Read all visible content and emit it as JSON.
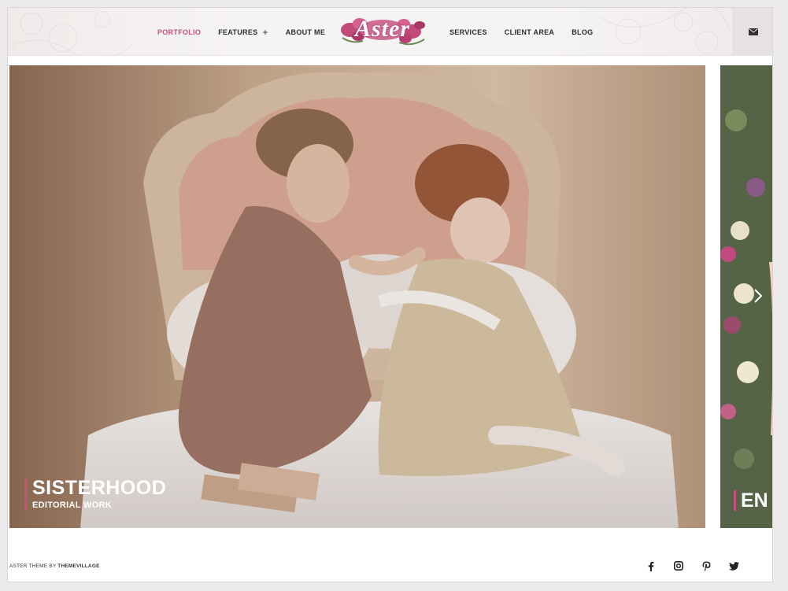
{
  "header": {
    "logo_text": "Aster",
    "nav_left": [
      {
        "label": "PORTFOLIO",
        "active": true
      },
      {
        "label": "FEATURES",
        "has_submenu": true
      },
      {
        "label": "ABOUT ME"
      }
    ],
    "nav_right": [
      {
        "label": "SERVICES"
      },
      {
        "label": "CLIENT AREA"
      },
      {
        "label": "BLOG"
      }
    ],
    "mail_icon": "envelope-icon"
  },
  "slider": {
    "current": {
      "title": "SISTERHOOD",
      "subtitle": "EDITORIAL WORK"
    },
    "next": {
      "title_partial": "EN"
    },
    "next_arrow_icon": "chevron-right-icon"
  },
  "footer": {
    "credit_prefix": "ASTER THEME BY",
    "credit_brand": "THEMEVILLAGE",
    "social": [
      "facebook-icon",
      "instagram-icon",
      "pinterest-icon",
      "twitter-icon"
    ]
  },
  "colors": {
    "accent": "#c94f7c",
    "text": "#2c2c2c"
  }
}
